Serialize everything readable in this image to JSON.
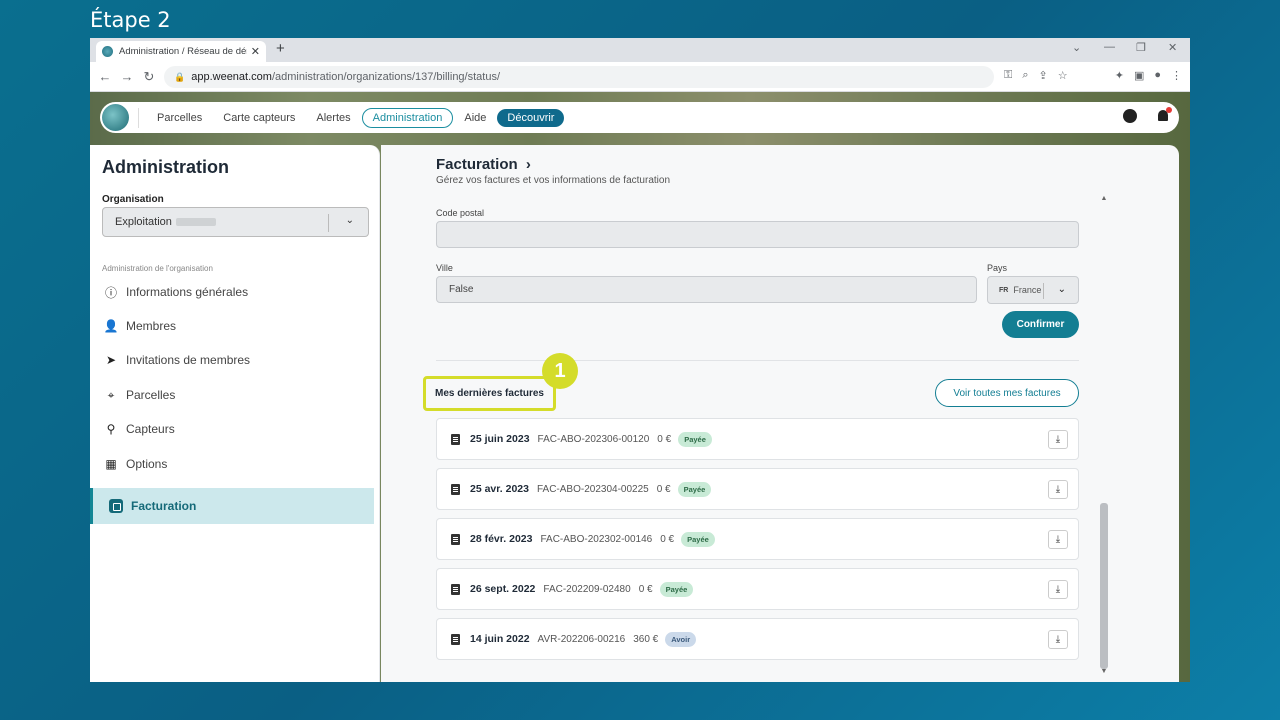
{
  "step_title": "Étape 2",
  "browser": {
    "tab_title": "Administration / Réseau de démo",
    "url_host": "app.weenat.com",
    "url_path": "/administration/organizations/137/billing/status/"
  },
  "topnav": {
    "items": [
      "Parcelles",
      "Carte capteurs",
      "Alertes",
      "Administration",
      "Aide",
      "Découvrir"
    ]
  },
  "sidebar": {
    "title": "Administration",
    "org_label": "Organisation",
    "org_value": "Exploitation",
    "section_label": "Administration de l'organisation",
    "items": [
      "Informations générales",
      "Membres",
      "Invitations de membres",
      "Parcelles",
      "Capteurs",
      "Options"
    ],
    "active_item": "Facturation"
  },
  "main": {
    "title": "Facturation",
    "title_chevron": "›",
    "subtitle": "Gérez vos factures et vos informations de facturation",
    "postal_label": "Code postal",
    "postal_value": "",
    "city_label": "Ville",
    "city_value": "False",
    "country_label": "Pays",
    "country_code": "FR",
    "country_value": "France",
    "confirm_label": "Confirmer",
    "recent_invoices_label": "Mes dernières factures",
    "step_number": "1",
    "view_all_label": "Voir toutes mes factures",
    "invoices": [
      {
        "date": "25 juin 2023",
        "number": "FAC-ABO-202306-00120",
        "amount": "0 €",
        "status": "Payée",
        "status_type": "paid"
      },
      {
        "date": "25 avr. 2023",
        "number": "FAC-ABO-202304-00225",
        "amount": "0 €",
        "status": "Payée",
        "status_type": "paid"
      },
      {
        "date": "28 févr. 2023",
        "number": "FAC-ABO-202302-00146",
        "amount": "0 €",
        "status": "Payée",
        "status_type": "paid"
      },
      {
        "date": "26 sept. 2022",
        "number": "FAC-202209-02480",
        "amount": "0 €",
        "status": "Payée",
        "status_type": "paid"
      },
      {
        "date": "14 juin 2022",
        "number": "AVR-202206-00216",
        "amount": "360 €",
        "status": "Avoir",
        "status_type": "avoir"
      }
    ]
  },
  "colors": {
    "accent": "#137e93",
    "highlight": "#d4dc2a",
    "active_bg": "#cce8ec"
  }
}
